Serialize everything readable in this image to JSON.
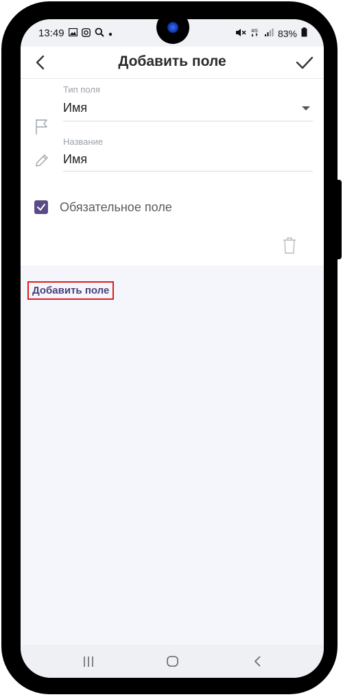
{
  "status_bar": {
    "time": "13:49",
    "left_icons": [
      "image-icon",
      "instagram-icon",
      "search-icon",
      "dot-icon"
    ],
    "right_icons": [
      "mute-icon",
      "4g-icon",
      "signal-icon"
    ],
    "battery_text": "83%"
  },
  "app_bar": {
    "title": "Добавить поле"
  },
  "form": {
    "field_type": {
      "label": "Тип поля",
      "value": "Имя"
    },
    "field_name": {
      "label": "Название",
      "value": "Имя"
    },
    "required": {
      "label": "Обязательное поле",
      "checked": true
    }
  },
  "actions": {
    "add_field_label": "Добавить поле"
  },
  "colors": {
    "accent": "#5b4a86",
    "highlight_border": "#e01b1b",
    "background": "#f4f6fc"
  }
}
